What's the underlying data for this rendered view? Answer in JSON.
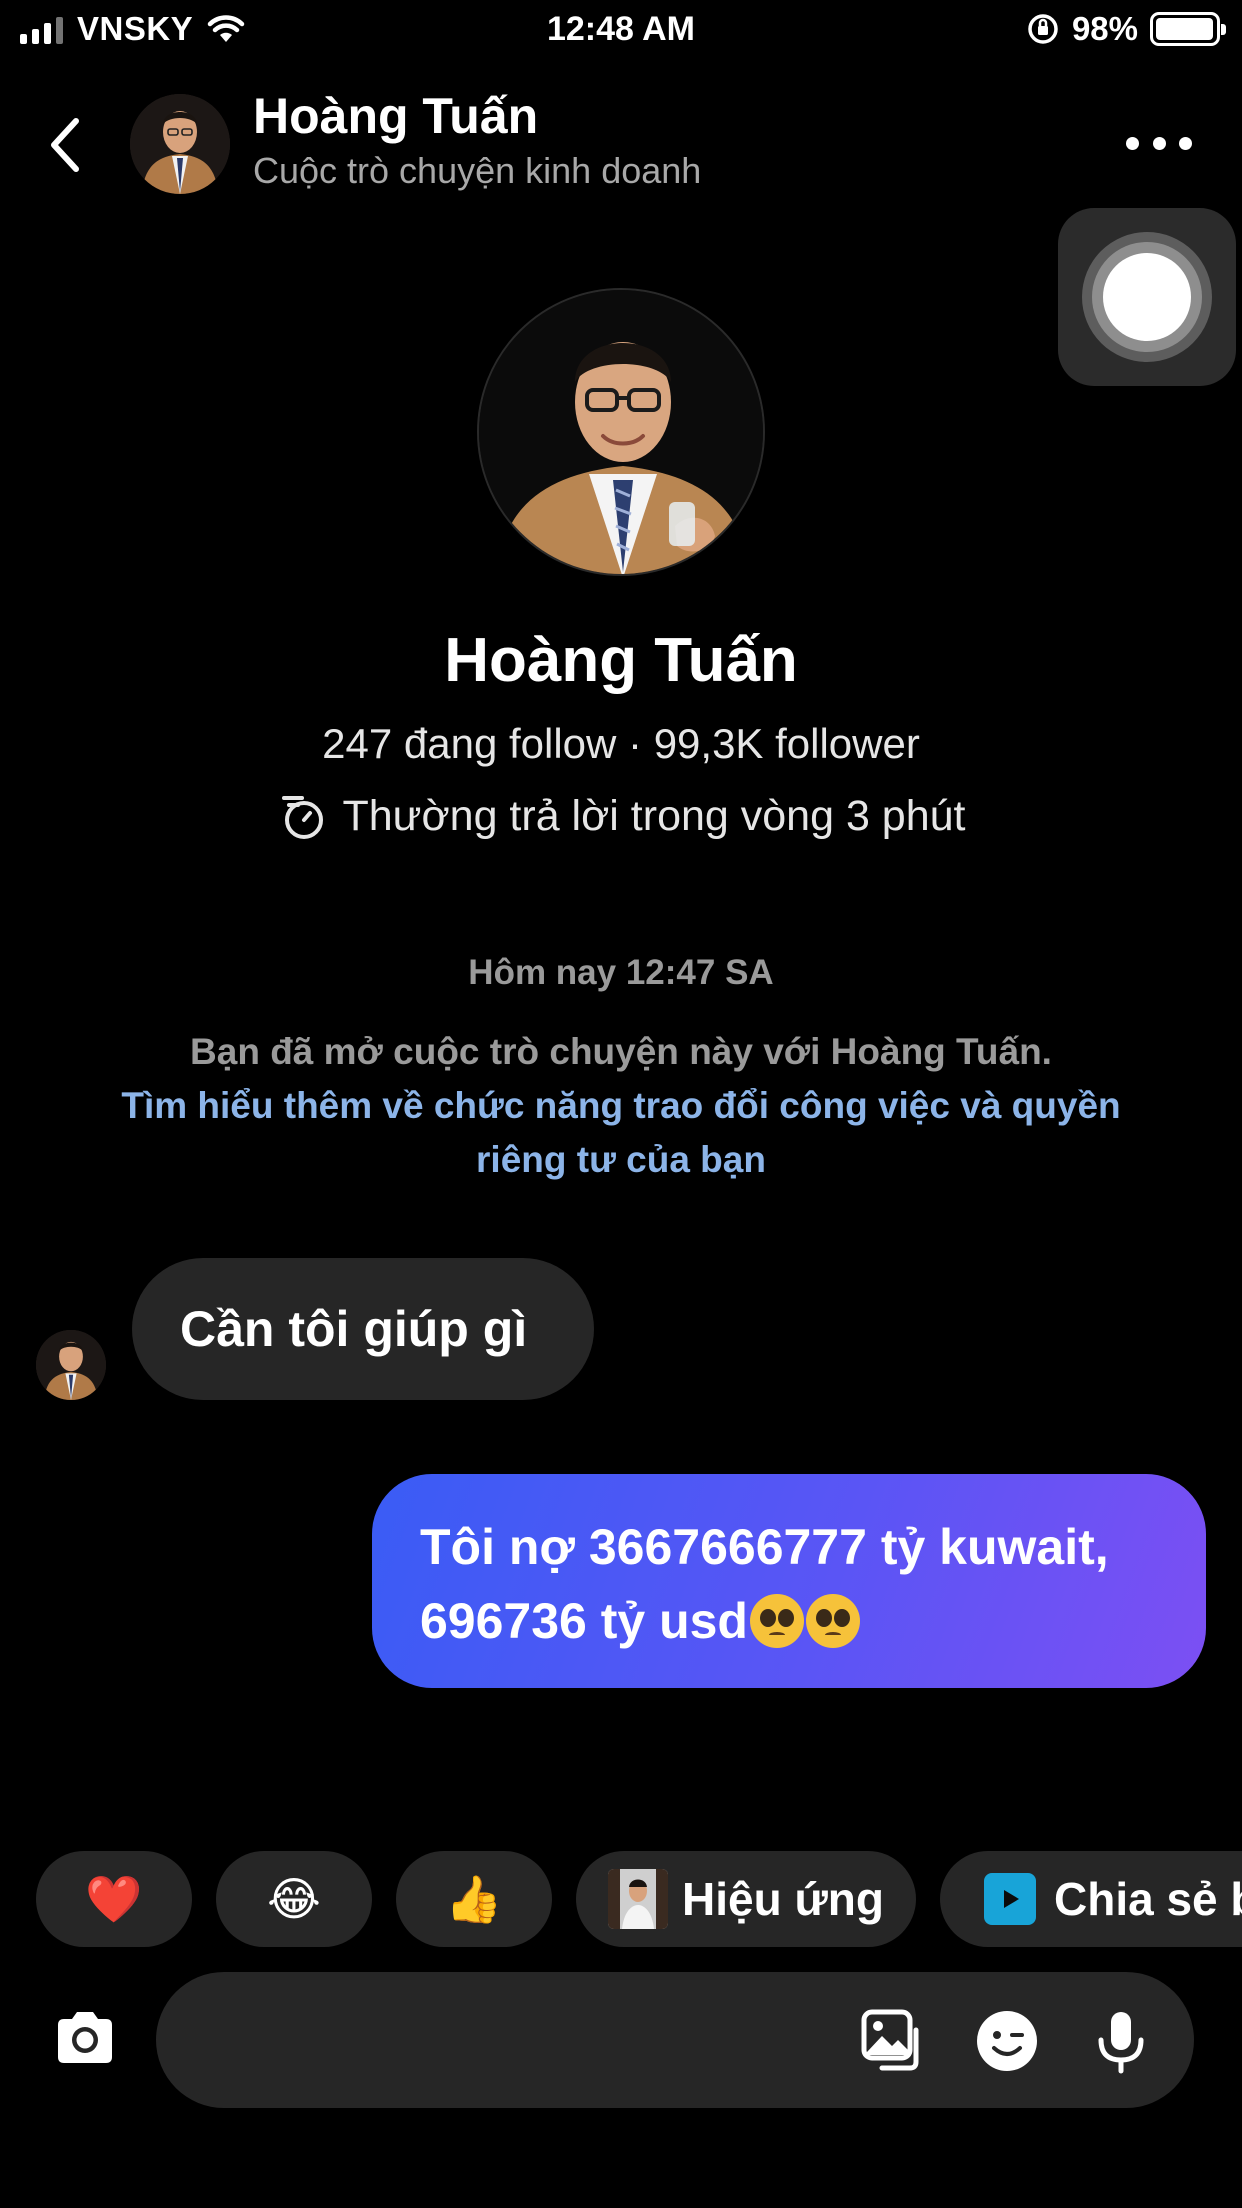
{
  "status_bar": {
    "carrier": "VNSKY",
    "time": "12:48 AM",
    "battery": "98%",
    "battery_level": 0.98
  },
  "header": {
    "name": "Hoàng Tuấn",
    "subtitle": "Cuộc trò chuyện kinh doanh"
  },
  "profile": {
    "name": "Hoàng Tuấn",
    "stats": "247 đang follow · 99,3K follower",
    "reply_time": "Thường trả lời trong vòng 3 phút"
  },
  "conversation": {
    "timestamp": "Hôm nay 12:47 SA",
    "notice_text": "Bạn đã mở cuộc trò chuyện này với Hoàng Tuấn.",
    "notice_link": "Tìm hiểu thêm về chức năng trao đổi công việc và quyền riêng tư của bạn"
  },
  "messages": [
    {
      "from": "them",
      "text": "Cần tôi giúp gì"
    },
    {
      "from": "me",
      "line1": "Tôi nợ 3667666777 tỷ kuwait,",
      "line2": "696736 tỷ usd",
      "emoji": [
        "pleading-face",
        "pleading-face"
      ]
    }
  ],
  "quick_replies": {
    "heart": "❤️",
    "laugh": "😂",
    "like": "👍",
    "effects_label": "Hiệu ứng",
    "share_label": "Chia sẻ b"
  },
  "composer": {
    "placeholder": "",
    "icons": [
      "camera-icon",
      "gallery-icon",
      "sticker-icon",
      "microphone-icon"
    ]
  },
  "colors": {
    "background": "#000000",
    "bubble_in": "#262626",
    "bubble_out_start": "#3a5cf5",
    "bubble_out_end": "#7c4ff3",
    "link": "#8cb4e8"
  }
}
